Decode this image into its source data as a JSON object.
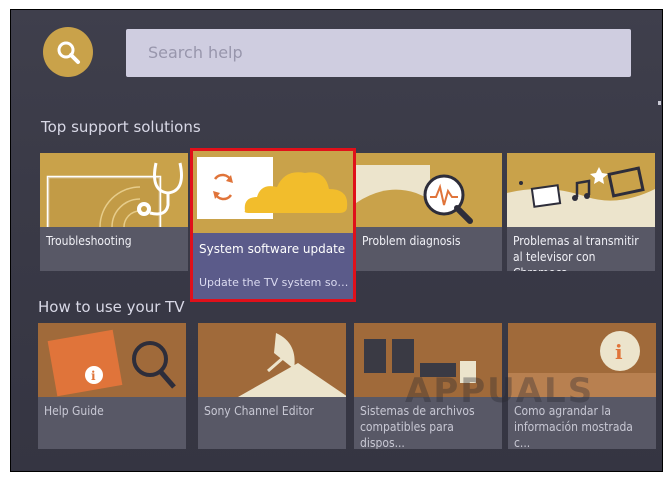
{
  "search": {
    "placeholder": "Search help",
    "icon": "search-icon"
  },
  "sections": {
    "top": {
      "title": "Top support solutions",
      "cards": [
        {
          "label": "Troubleshooting",
          "icon": "stethoscope-icon"
        },
        {
          "label": "System software update",
          "subtitle": "Update the TV system softw...",
          "icon": "cloud-refresh-icon",
          "selected": true
        },
        {
          "label": "Problem diagnosis",
          "icon": "magnifier-waveform-icon"
        },
        {
          "label": "Problemas al transmitir al televisor con Chromeca...",
          "icon": "film-music-icon"
        }
      ]
    },
    "how_to": {
      "title": "How to use your TV",
      "cards": [
        {
          "label": "Help Guide",
          "icon": "info-book-icon"
        },
        {
          "label": "Sony Channel Editor",
          "icon": "satellite-dish-icon"
        },
        {
          "label": "Sistemas de archivos compatibles para dispos...",
          "icon": "devices-icon"
        },
        {
          "label": "Como agrandar la información mostrada c...",
          "icon": "info-bubble-icon"
        }
      ]
    }
  },
  "watermark": "APPUALS",
  "colors": {
    "accent_gold": "#c9a24a",
    "selected_border": "#e0101a",
    "selected_body": "#5b5b8a",
    "background": "#3c3c49"
  }
}
